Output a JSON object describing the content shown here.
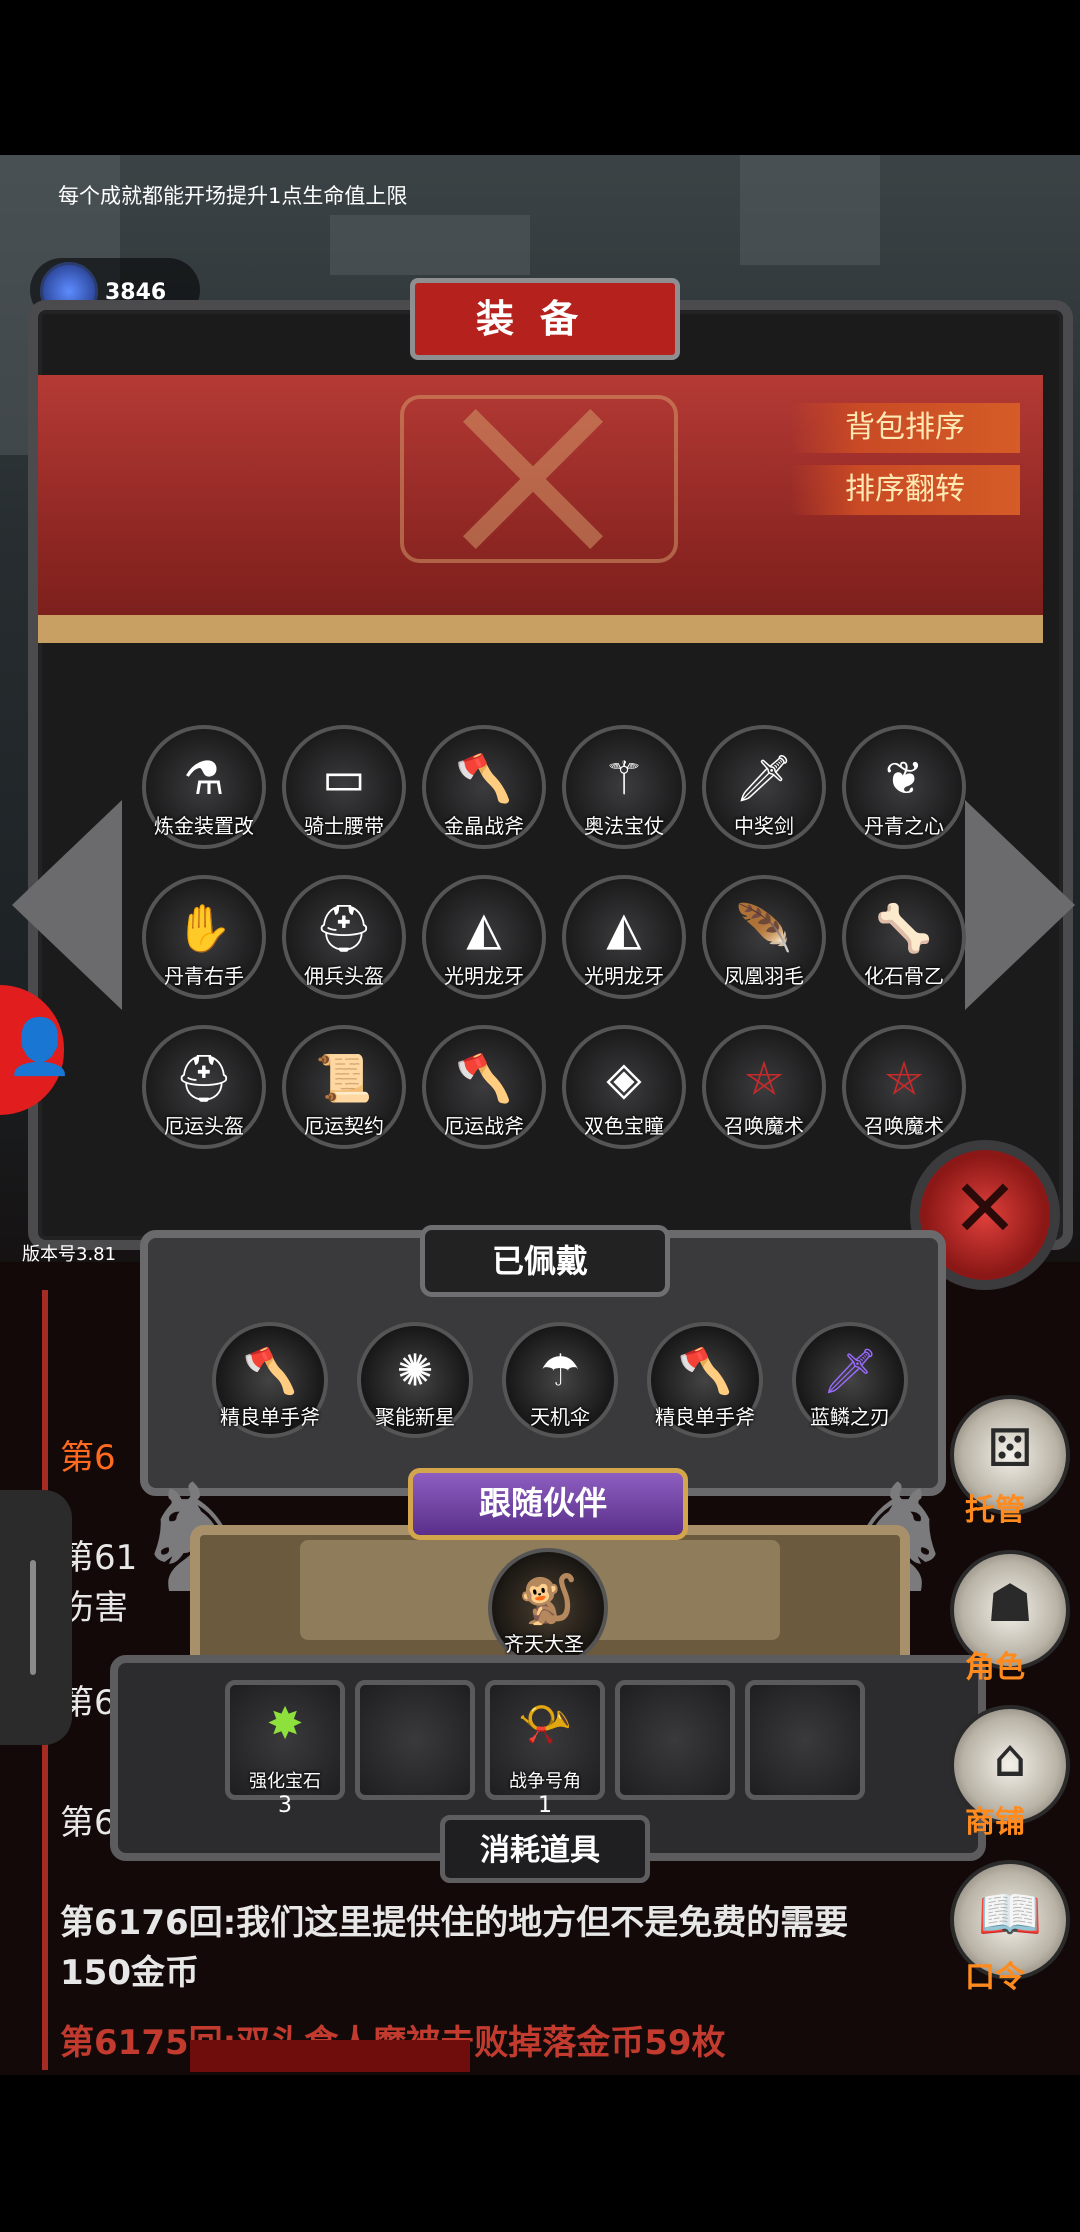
{
  "top_hint": "每个成就都能开场提升1点生命值上限",
  "currency": {
    "label": "宝石",
    "count": "3846",
    "icon": "blue-gem-icon"
  },
  "panel": {
    "title": "装备",
    "sort_label": "背包排序",
    "flip_label": "排序翻转"
  },
  "inventory": [
    {
      "label": "炼金装置改",
      "icon": "flask-icon"
    },
    {
      "label": "骑士腰带",
      "icon": "belt-icon"
    },
    {
      "label": "金晶战斧",
      "icon": "battle-axe-icon"
    },
    {
      "label": "奥法宝仗",
      "icon": "staff-icon"
    },
    {
      "label": "中奖剑",
      "icon": "sword-icon"
    },
    {
      "label": "丹青之心",
      "icon": "heart-amulet-icon"
    },
    {
      "label": "丹青右手",
      "icon": "gauntlet-icon"
    },
    {
      "label": "佣兵头盔",
      "icon": "helmet-icon"
    },
    {
      "label": "光明龙牙",
      "icon": "dragon-fang-icon"
    },
    {
      "label": "光明龙牙",
      "icon": "dragon-fang-icon"
    },
    {
      "label": "凤凰羽毛",
      "icon": "phoenix-feather-icon"
    },
    {
      "label": "化石骨乙",
      "icon": "bone-icon"
    },
    {
      "label": "厄运头盔",
      "icon": "doom-helmet-icon"
    },
    {
      "label": "厄运契约",
      "icon": "scroll-icon"
    },
    {
      "label": "厄运战斧",
      "icon": "doom-axe-icon"
    },
    {
      "label": "双色宝瞳",
      "icon": "gem-pendant-icon"
    },
    {
      "label": "召唤魔术",
      "icon": "pentagram-icon"
    },
    {
      "label": "召唤魔术",
      "icon": "pentagram-icon"
    }
  ],
  "version": "版本号3.81",
  "equipped": {
    "title": "已佩戴",
    "items": [
      {
        "label": "精良单手斧",
        "icon": "hand-axe-icon"
      },
      {
        "label": "聚能新星",
        "icon": "nova-orb-icon"
      },
      {
        "label": "天机伞",
        "icon": "umbrella-icon"
      },
      {
        "label": "精良单手斧",
        "icon": "hand-axe-icon"
      },
      {
        "label": "蓝鳞之刃",
        "icon": "blue-blade-icon"
      }
    ]
  },
  "companion": {
    "title": "跟随伙伴",
    "name": "齐天大圣",
    "icon": "monkey-king-icon"
  },
  "consumables": {
    "title": "消耗道具",
    "slots": [
      {
        "label": "强化宝石",
        "count": "3",
        "icon": "green-gem-icon"
      },
      {
        "label": "",
        "count": "",
        "icon": ""
      },
      {
        "label": "战争号角",
        "count": "1",
        "icon": "war-horn-icon"
      },
      {
        "label": "",
        "count": "",
        "icon": ""
      },
      {
        "label": "",
        "count": "",
        "icon": ""
      }
    ]
  },
  "log": {
    "lines": [
      "第6",
      "第61",
      "伤害",
      "第6",
      "第6",
      "第6176回:我们这里提供住的地方但不是免费的需要",
      "150金币",
      "第6175回:双头食人魔被击败掉落金币59枚"
    ]
  },
  "side_menu": [
    {
      "label": "托管",
      "icon": "dice-icon"
    },
    {
      "label": "角色",
      "icon": "hooded-figure-icon"
    },
    {
      "label": "商铺",
      "icon": "shop-icon"
    },
    {
      "label": "口令",
      "icon": "code-book-icon"
    }
  ]
}
